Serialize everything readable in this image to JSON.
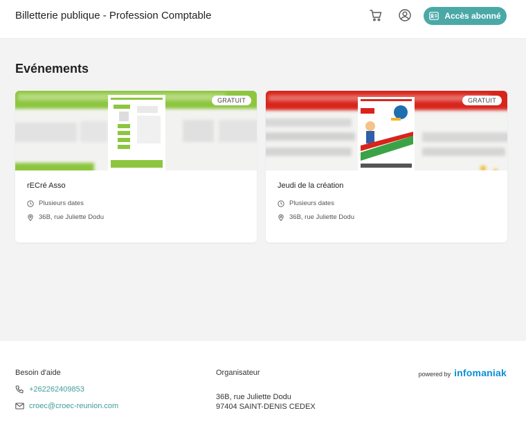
{
  "header": {
    "title": "Billetterie publique - Profession Comptable",
    "subscriber_button": "Accès abonné"
  },
  "events_section": {
    "title": "Evénements"
  },
  "events": [
    {
      "badge": "GRATUIT",
      "title": "rECré Asso",
      "dates": "Plusieurs dates",
      "location": "36B, rue Juliette Dodu",
      "banner_color": "#8cc63f"
    },
    {
      "badge": "GRATUIT",
      "title": "Jeudi de la création",
      "dates": "Plusieurs dates",
      "location": "36B, rue Juliette Dodu",
      "banner_color": "#d7251c"
    }
  ],
  "footer": {
    "help": {
      "title": "Besoin d'aide",
      "phone": "+262262409853",
      "email": "croec@croec-reunion.com"
    },
    "organizer": {
      "title": "Organisateur",
      "address_line1": "36B, rue Juliette Dodu",
      "address_line2": "97404 SAINT-DENIS CEDEX"
    },
    "powered_by": {
      "label": "powered by",
      "brand": "infomaniak"
    }
  },
  "colors": {
    "accent": "#4aa9a7",
    "link": "#3f9c9a",
    "brand_infomaniak": "#0a8fd6"
  }
}
